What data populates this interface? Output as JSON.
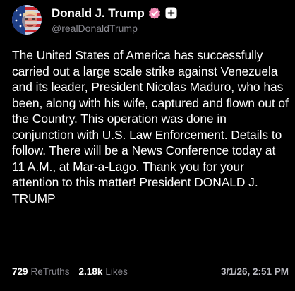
{
  "post": {
    "author": {
      "display_name": "Donald J. Trump",
      "handle": "@realDonaldTrump",
      "verified": true,
      "verified_color": "#f08bb5",
      "icons": {
        "avatar": "avatar-image",
        "verified": "verified-badge-icon",
        "follow": "plus-icon"
      }
    },
    "body": "The United States of America has successfully carried out a large scale strike against Venezuela and its leader, President Nicolas Maduro, who has been, along with his wife, captured and flown out of the Country. This operation was done in conjunction with U.S. Law Enforcement. Details to follow. There will be a News Conference today at 11 A.M., at Mar-a-Lago. Thank you for your attention to this matter! President DONALD J. TRUMP",
    "stats": {
      "retruths_count": "729",
      "retruths_label": "ReTruths",
      "likes_count": "2.18k",
      "likes_label": "Likes"
    },
    "timestamp": "3/1/26, 2:51 PM"
  },
  "colors": {
    "background": "#000000",
    "text": "#ffffff",
    "muted": "#8b8b93",
    "timestamp": "#b9b9c0"
  }
}
